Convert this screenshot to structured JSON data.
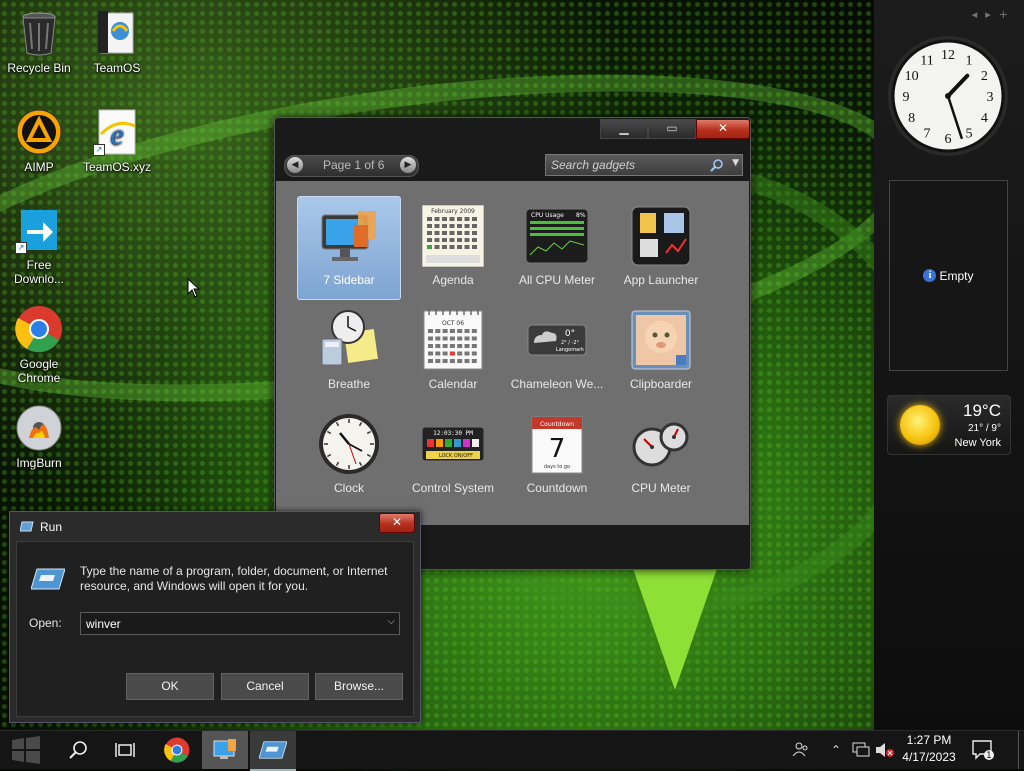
{
  "desktop": {
    "icons": [
      {
        "label": "Recycle Bin",
        "icon": "recycle-bin-icon"
      },
      {
        "label": "TeamOS",
        "icon": "folder-icon"
      },
      {
        "label": "AIMP",
        "icon": "aimp-icon"
      },
      {
        "label": "TeamOS.xyz",
        "icon": "internet-explorer-icon"
      },
      {
        "label": "Free Downlo...",
        "icon": "free-download-manager-icon"
      },
      {
        "label": "Google Chrome",
        "icon": "chrome-icon"
      },
      {
        "label": "ImgBurn",
        "icon": "imgburn-icon"
      }
    ]
  },
  "sidebar": {
    "clock": {
      "numerals": [
        "12",
        "1",
        "2",
        "3",
        "4",
        "5",
        "6",
        "7",
        "8",
        "9",
        "10",
        "11"
      ],
      "hour_hand": "1:27",
      "minute": 27
    },
    "empty_gadget": {
      "label": "Empty"
    },
    "weather": {
      "temp": "19°C",
      "range": "21° / 9°",
      "city": "New York"
    }
  },
  "gallery": {
    "pager": {
      "label": "Page 1 of 6"
    },
    "search": {
      "placeholder": "Search gadgets"
    },
    "buttons": {
      "minimize": "▁",
      "maximize": "▭",
      "close": "✕"
    },
    "gadgets": [
      {
        "name": "7 Sidebar",
        "icon": "sidebar-icon",
        "selected": true
      },
      {
        "name": "Agenda",
        "icon": "calendar-month-icon"
      },
      {
        "name": "All CPU Meter",
        "icon": "cpu-meter-panel-icon"
      },
      {
        "name": "App Launcher",
        "icon": "app-launcher-icon"
      },
      {
        "name": "Breathe",
        "icon": "breathe-clock-icon"
      },
      {
        "name": "Calendar",
        "icon": "calendar-icon"
      },
      {
        "name": "Chameleon We...",
        "icon": "weather-icon"
      },
      {
        "name": "Clipboarder",
        "icon": "clipboarder-icon"
      },
      {
        "name": "Clock",
        "icon": "clock-icon"
      },
      {
        "name": "Control System",
        "icon": "control-system-icon"
      },
      {
        "name": "Countdown",
        "icon": "countdown-icon"
      },
      {
        "name": "CPU Meter",
        "icon": "cpu-meter-icon"
      }
    ],
    "thumb_text": {
      "agenda_header": "February 2009",
      "cpu_title": "CPU Usage",
      "cpu_pct": "8%",
      "cal_month": "OCT 06",
      "weather_temp": "0°",
      "weather_range": "2° / -2°",
      "weather_city": "Langemark",
      "control_time": "12:03:30 PM",
      "control_lock": "LOCK ON/OFF",
      "countdown_title": "Countdown",
      "countdown_num": "7",
      "countdown_sub": "days to go"
    }
  },
  "run_dialog": {
    "title": "Run",
    "close": "✕",
    "description": "Type the name of a program, folder, document, or Internet resource, and Windows will open it for you.",
    "open_label": "Open:",
    "open_value": "winver",
    "ok": "OK",
    "cancel": "Cancel",
    "browse": "Browse..."
  },
  "taskbar": {
    "time": "1:27 PM",
    "date": "4/17/2023",
    "notification_count": "1"
  },
  "colors": {
    "accent": "#3a72d6",
    "close_red": "#b7301e",
    "selection": "#a9c8ea",
    "wallpaper_green": "#2f6d12"
  }
}
